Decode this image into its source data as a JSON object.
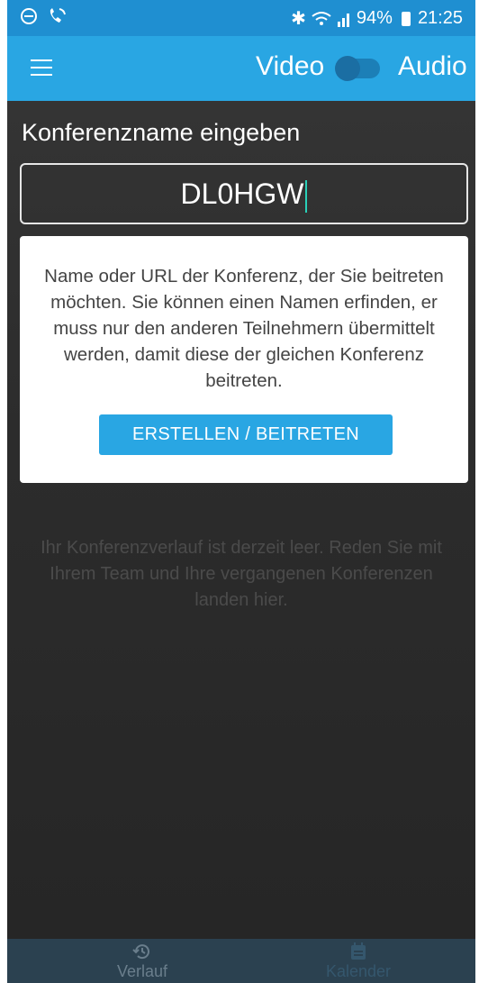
{
  "status_bar": {
    "battery": "94%",
    "time": "21:25"
  },
  "app_bar": {
    "video_label": "Video",
    "audio_label": "Audio"
  },
  "conference": {
    "heading": "Konferenzname eingeben",
    "input_value": "DL0HGW"
  },
  "info_card": {
    "description": "Name oder URL der Konferenz, der Sie beitreten möchten. Sie können einen Namen erfinden, er muss nur den anderen Teilnehmern übermittelt werden, damit diese der gleichen Konferenz beitreten.",
    "button_label": "ERSTELLEN / BEITRETEN"
  },
  "history": {
    "empty_text": "Ihr Konferenzverlauf ist derzeit leer. Reden Sie mit Ihrem Team und Ihre vergangenen Konferenzen landen hier."
  },
  "bottom_nav": {
    "items": [
      {
        "label": "Verlauf",
        "icon": "history-icon"
      },
      {
        "label": "Kalender",
        "icon": "calendar-icon"
      }
    ]
  },
  "colors": {
    "app_bar": "#29a6e3",
    "status_bar": "#1f8fd1",
    "button": "#29a6e3",
    "bottom_nav": "#2b4150"
  }
}
